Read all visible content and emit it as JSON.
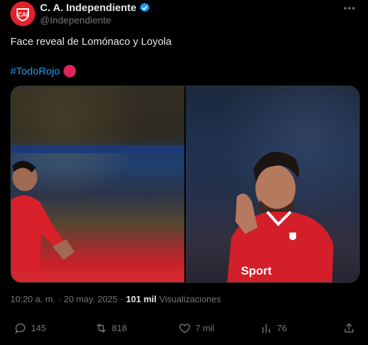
{
  "account": {
    "display_name": "C. A. Independiente",
    "handle": "@Independiente",
    "verified": true,
    "avatar_icon": "independiente-crest-icon",
    "brand_color": "#e1222a"
  },
  "tweet": {
    "text": "Face reveal de Lomónaco y Loyola",
    "hashtag": "#TodoRojo",
    "emoji_icon": "red-circle-icon"
  },
  "meta": {
    "time": "10:20 a. m.",
    "date": "20 may. 2025",
    "views_count": "101 mil",
    "views_label": "Visualizaciones"
  },
  "actions": {
    "replies": "145",
    "retweets": "818",
    "likes": "7 mil",
    "bookmarks": "76"
  },
  "media_photo_sponsor_text": "Sport"
}
